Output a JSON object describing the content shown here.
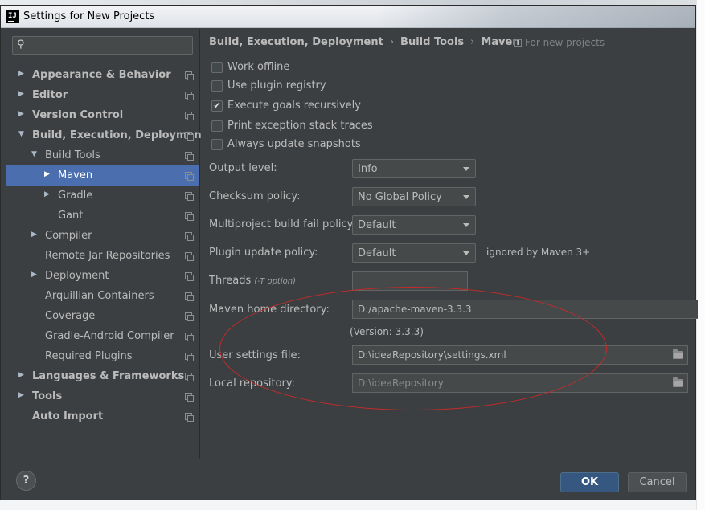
{
  "window": {
    "title": "Settings for New Projects",
    "app_icon_text": "IJ"
  },
  "sidebar": {
    "search": {
      "value": "",
      "placeholder": ""
    },
    "items": [
      {
        "label": "Appearance & Behavior",
        "arrow": "▶",
        "bold": true
      },
      {
        "label": "Editor",
        "arrow": "▶",
        "bold": true
      },
      {
        "label": "Version Control",
        "arrow": "▶",
        "bold": true
      },
      {
        "label": "Build, Execution, Deployment",
        "arrow": "▼",
        "bold": true
      },
      {
        "label": "Build Tools",
        "arrow": "▼",
        "bold": false
      },
      {
        "label": "Maven",
        "arrow": "▶",
        "bold": false,
        "selected": true
      },
      {
        "label": "Gradle",
        "arrow": "▶",
        "bold": false
      },
      {
        "label": "Gant",
        "arrow": "",
        "bold": false
      },
      {
        "label": "Compiler",
        "arrow": "▶",
        "bold": false
      },
      {
        "label": "Remote Jar Repositories",
        "arrow": "",
        "bold": false
      },
      {
        "label": "Deployment",
        "arrow": "▶",
        "bold": false
      },
      {
        "label": "Arquillian Containers",
        "arrow": "",
        "bold": false
      },
      {
        "label": "Coverage",
        "arrow": "",
        "bold": false
      },
      {
        "label": "Gradle-Android Compiler",
        "arrow": "",
        "bold": false
      },
      {
        "label": "Required Plugins",
        "arrow": "",
        "bold": false
      },
      {
        "label": "Languages & Frameworks",
        "arrow": "▶",
        "bold": true
      },
      {
        "label": "Tools",
        "arrow": "▶",
        "bold": true
      },
      {
        "label": "Auto Import",
        "arrow": "",
        "bold": true
      }
    ]
  },
  "breadcrumb": {
    "items": [
      "Build, Execution, Deployment",
      "Build Tools",
      "Maven"
    ],
    "separator": "›",
    "scope_note": "For new projects"
  },
  "options": [
    {
      "label": "Work offline",
      "checked": false
    },
    {
      "label": "Use plugin registry",
      "checked": false
    },
    {
      "label": "Execute goals recursively",
      "checked": true
    },
    {
      "label": "Print exception stack traces",
      "checked": false
    },
    {
      "label": "Always update snapshots",
      "checked": false
    }
  ],
  "check_mark": "✔",
  "fields": {
    "output_level": {
      "label": "Output level:",
      "value": "Info"
    },
    "checksum_policy": {
      "label": "Checksum policy:",
      "value": "No Global Policy"
    },
    "multiproject_fail_policy": {
      "label": "Multiproject build fail policy:",
      "value": "Default"
    },
    "plugin_update_policy": {
      "label": "Plugin update policy:",
      "value": "Default",
      "note": "ignored by Maven 3+"
    },
    "threads": {
      "label": "Threads",
      "hint": "(-T option)",
      "value": ""
    },
    "maven_home": {
      "label": "Maven home directory:",
      "value": "D:/apache-maven-3.3.3",
      "version": "(Version: 3.3.3)"
    },
    "user_settings": {
      "label": "User settings file:",
      "value": "D:\\ideaRepository\\settings.xml"
    },
    "local_repository": {
      "label": "Local repository:",
      "value": "D:\\ideaRepository"
    }
  },
  "buttons": {
    "help": "?",
    "ok": "OK",
    "cancel": "Cancel"
  },
  "colors": {
    "background": "#3c3f41",
    "selection": "#4b6eaf",
    "ok_button": "#365880",
    "annotation": "#c42b2b"
  }
}
